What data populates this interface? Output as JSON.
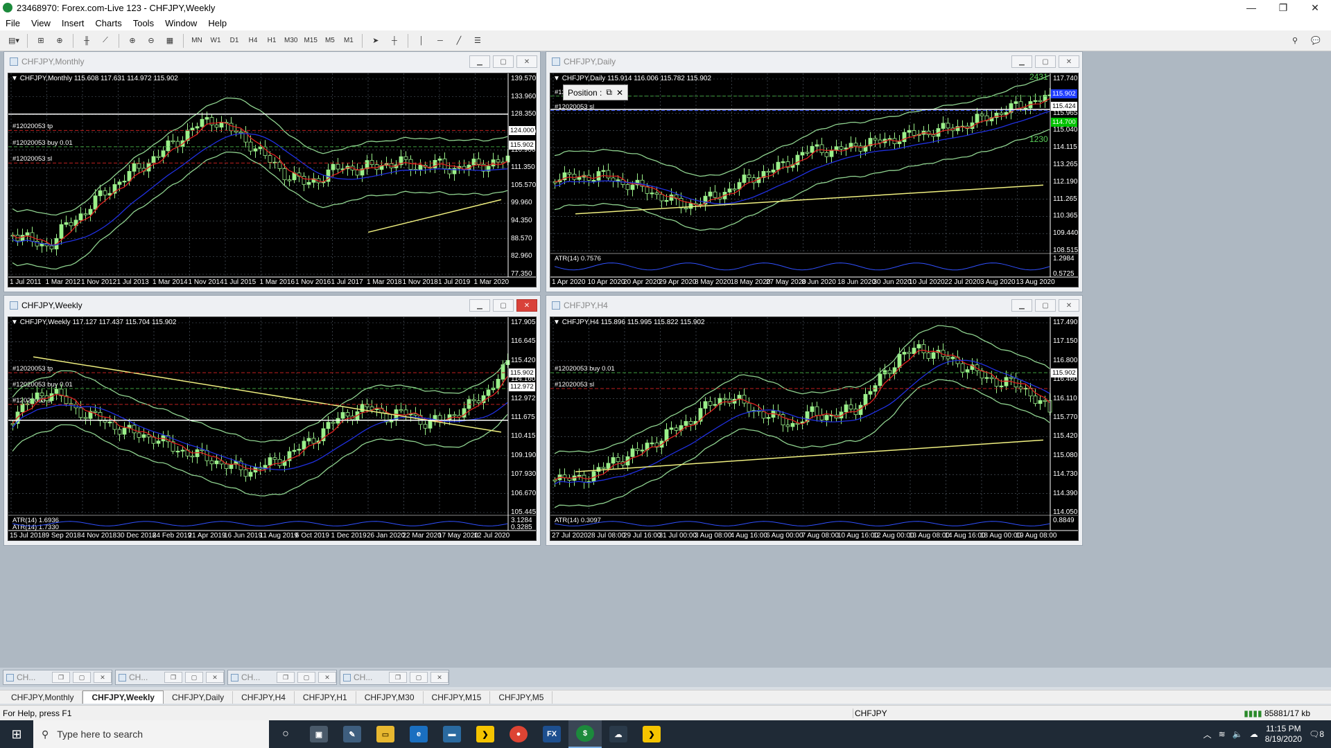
{
  "window": {
    "title": "23468970: Forex.com-Live 123 - CHFJPY,Weekly",
    "min": "—",
    "max": "❐",
    "close": "✕"
  },
  "menu": [
    "File",
    "View",
    "Insert",
    "Charts",
    "Tools",
    "Window",
    "Help"
  ],
  "toolbar": {
    "timeframes": [
      "MN",
      "W1",
      "D1",
      "H4",
      "H1",
      "M30",
      "M15",
      "M5",
      "M1"
    ]
  },
  "charts": [
    {
      "key": "monthly",
      "title": "CHFJPY,Monthly",
      "info": "CHFJPY,Monthly  115.608 117.631 114.972 115.902",
      "yticks": [
        "139.570",
        "133.960",
        "128.350",
        "122.570",
        "116.960",
        "111.350",
        "105.570",
        "99.960",
        "94.350",
        "88.570",
        "82.960",
        "77.350"
      ],
      "xticks": [
        "1 Jul 2011",
        "1 Mar 2012",
        "1 Nov 2012",
        "1 Jul 2013",
        "1 Mar 2014",
        "1 Nov 2014",
        "1 Jul 2015",
        "1 Mar 2016",
        "1 Nov 2016",
        "1 Jul 2017",
        "1 Mar 2018",
        "1 Nov 2018",
        "1 Jul 2019",
        "1 Mar 2020"
      ],
      "price_boxes": [
        {
          "text": "124.000",
          "bg": "#ffffff",
          "fg": "#000000"
        },
        {
          "text": "115.902",
          "bg": "#ffffff",
          "fg": "#000000"
        }
      ],
      "orders": [
        "#12020053 tp",
        "#12020053 buy 0.01",
        "#12020053 sl"
      ],
      "active": false
    },
    {
      "key": "daily",
      "title": "CHFJPY,Daily",
      "info": "CHFJPY,Daily  115.914 116.006 115.782 115.902",
      "yticks": [
        "117.740",
        "116.815",
        "115.965",
        "115.040",
        "114.115",
        "113.265",
        "112.190",
        "111.265",
        "110.365",
        "109.440",
        "108.515"
      ],
      "xticks": [
        "1 Apr 2020",
        "10 Apr 2020",
        "20 Apr 2020",
        "29 Apr 2020",
        "8 May 2020",
        "18 May 2020",
        "27 May 2020",
        "8 Jun 2020",
        "18 Jun 2020",
        "30 Jun 2020",
        "10 Jul 2020",
        "22 Jul 2020",
        "3 Aug 2020",
        "13 Aug 2020"
      ],
      "price_boxes": [
        {
          "text": "115.902",
          "bg": "#1e3cff",
          "fg": "#ffffff"
        },
        {
          "text": "115.424",
          "bg": "#ffffff",
          "fg": "#000000"
        },
        {
          "text": "114.700",
          "bg": "#00c000",
          "fg": "#ffffff"
        }
      ],
      "orders": [
        "#12020053 buy 0.01",
        "#12020053 sl"
      ],
      "atr": {
        "label": "ATR(14) 0.7576",
        "ticks": [
          "1.2984",
          "0.5725"
        ]
      },
      "extra": [
        "2431",
        "1230"
      ],
      "position": "Position :",
      "active": false
    },
    {
      "key": "weekly",
      "title": "CHFJPY,Weekly",
      "info": "CHFJPY,Weekly  117.127 117.437 115.704 115.902",
      "yticks": [
        "117.905",
        "116.645",
        "115.420",
        "114.160",
        "112.972",
        "111.675",
        "110.415",
        "109.190",
        "107.930",
        "106.670",
        "105.445"
      ],
      "xticks": [
        "15 Jul 2018",
        "9 Sep 2018",
        "4 Nov 2018",
        "30 Dec 2018",
        "24 Feb 2019",
        "21 Apr 2019",
        "16 Jun 2019",
        "11 Aug 2019",
        "6 Oct 2019",
        "1 Dec 2019",
        "26 Jan 2020",
        "22 Mar 2020",
        "17 May 2020",
        "12 Jul 2020"
      ],
      "price_boxes": [
        {
          "text": "115.902",
          "bg": "#ffffff",
          "fg": "#000000"
        },
        {
          "text": "112.972",
          "bg": "#ffffff",
          "fg": "#000000"
        }
      ],
      "orders": [
        "#12020053 tp",
        "#12020053 buy 0.01",
        "#12020053 sl"
      ],
      "atr": {
        "label": "ATR(14) 1.6936",
        "label2": "ATR(14) 1.7330",
        "ticks": [
          "3.1284",
          "0.3285"
        ]
      },
      "active": true
    },
    {
      "key": "h4",
      "title": "CHFJPY,H4",
      "info": "CHFJPY,H4  115.896 115.995 115.822 115.902",
      "yticks": [
        "117.490",
        "117.150",
        "116.800",
        "116.460",
        "116.110",
        "115.770",
        "115.420",
        "115.080",
        "114.730",
        "114.390",
        "114.050"
      ],
      "xticks": [
        "27 Jul 2020",
        "28 Jul 08:00",
        "29 Jul 16:00",
        "31 Jul 00:00",
        "3 Aug 08:00",
        "4 Aug 16:00",
        "6 Aug 00:00",
        "7 Aug 08:00",
        "10 Aug 16:00",
        "12 Aug 00:00",
        "13 Aug 08:00",
        "14 Aug 16:00",
        "18 Aug 00:00",
        "19 Aug 08:00"
      ],
      "price_boxes": [
        {
          "text": "115.902",
          "bg": "#ffffff",
          "fg": "#000000"
        }
      ],
      "orders": [
        "#12020053 buy 0.01",
        "#12020053 sl"
      ],
      "atr": {
        "label": "ATR(14) 0.3097",
        "ticks": [
          "0.8849"
        ]
      },
      "active": false
    }
  ],
  "minimized": [
    {
      "label": "CH..."
    },
    {
      "label": "CH..."
    },
    {
      "label": "CH..."
    },
    {
      "label": "CH..."
    }
  ],
  "tabs": [
    "CHFJPY,Monthly",
    "CHFJPY,Weekly",
    "CHFJPY,Daily",
    "CHFJPY,H4",
    "CHFJPY,H1",
    "CHFJPY,M30",
    "CHFJPY,M15",
    "CHFJPY,M5"
  ],
  "selected_tab": "CHFJPY,Weekly",
  "status": {
    "help": "For Help, press F1",
    "symbol": "CHFJPY",
    "traffic": "85881/17 kb"
  },
  "taskbar": {
    "search_placeholder": "Type here to search",
    "time": "11:15 PM",
    "date": "8/19/2020",
    "notif": "8"
  },
  "colors": {
    "bull": "#9bf08a",
    "bear": "#000000",
    "ma_fast": "#e02020",
    "ma_slow": "#2030e0",
    "bands": "#8fd28f",
    "grid": "#5a6570",
    "sma_long": "#f0f080"
  }
}
